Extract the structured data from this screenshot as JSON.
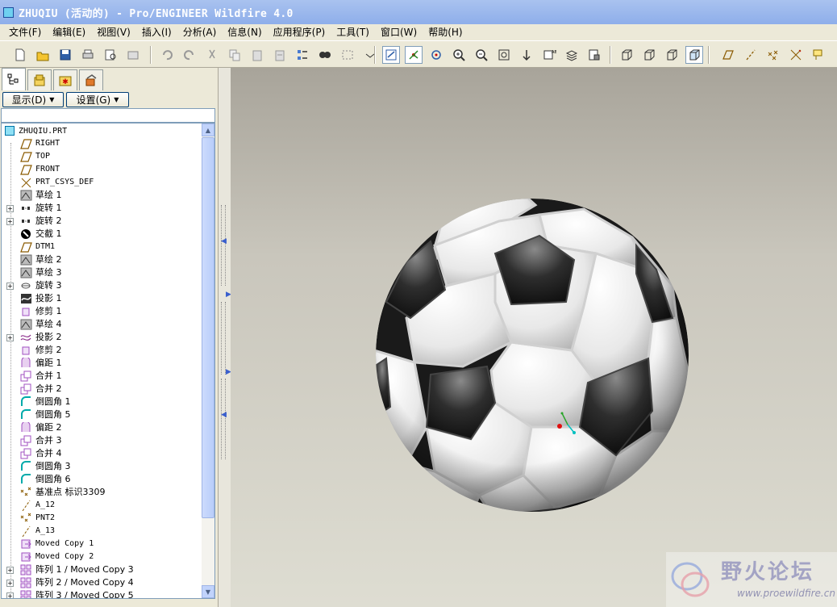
{
  "window": {
    "title": "ZHUQIU (活动的) - Pro/ENGINEER Wildfire 4.0"
  },
  "menu": [
    {
      "label": "文件(F)"
    },
    {
      "label": "编辑(E)"
    },
    {
      "label": "视图(V)"
    },
    {
      "label": "插入(I)"
    },
    {
      "label": "分析(A)"
    },
    {
      "label": "信息(N)"
    },
    {
      "label": "应用程序(P)"
    },
    {
      "label": "工具(T)"
    },
    {
      "label": "窗口(W)"
    },
    {
      "label": "帮助(H)"
    }
  ],
  "toolbar_icons": [
    "new-file",
    "open-folder",
    "save",
    "print",
    "print-preview",
    "email",
    "undo",
    "redo",
    "cut",
    "copy",
    "paste",
    "paste-special",
    "regenerate",
    "find",
    "select-box",
    "saved-views",
    "repaint",
    "spin-center",
    "orient",
    "zoom-in",
    "zoom-out",
    "refit",
    "reorient",
    "named-views",
    "layers",
    "view-manager",
    "wireframe",
    "hidden-line",
    "no-hidden",
    "shading",
    "datum-plane",
    "datum-axis",
    "datum-point",
    "csys",
    "annotation"
  ],
  "panel": {
    "display_button": "显示(D)",
    "settings_button": "设置(G)"
  },
  "tree": {
    "root": "ZHUQIU.PRT",
    "items": [
      {
        "label": "RIGHT",
        "icon": "datum-plane",
        "expandable": false,
        "mono": true
      },
      {
        "label": "TOP",
        "icon": "datum-plane",
        "expandable": false,
        "mono": true
      },
      {
        "label": "FRONT",
        "icon": "datum-plane",
        "expandable": false,
        "mono": true
      },
      {
        "label": "PRT_CSYS_DEF",
        "icon": "csys",
        "expandable": false,
        "mono": true
      },
      {
        "label": "草绘 1",
        "icon": "sketch",
        "expandable": false
      },
      {
        "label": "旋转 1",
        "icon": "revolve",
        "expandable": true
      },
      {
        "label": "旋转 2",
        "icon": "revolve",
        "expandable": true
      },
      {
        "label": "交截 1",
        "icon": "intersect",
        "expandable": false
      },
      {
        "label": "DTM1",
        "icon": "datum-plane",
        "expandable": false,
        "mono": true
      },
      {
        "label": "草绘 2",
        "icon": "sketch",
        "expandable": false
      },
      {
        "label": "草绘 3",
        "icon": "sketch",
        "expandable": false
      },
      {
        "label": "旋转 3",
        "icon": "revolve-surface",
        "expandable": true
      },
      {
        "label": "投影 1",
        "icon": "project",
        "expandable": false
      },
      {
        "label": "修剪 1",
        "icon": "trim",
        "expandable": false
      },
      {
        "label": "草绘 4",
        "icon": "sketch",
        "expandable": false
      },
      {
        "label": "投影 2",
        "icon": "project-curve",
        "expandable": true
      },
      {
        "label": "修剪 2",
        "icon": "trim",
        "expandable": false
      },
      {
        "label": "偏距 1",
        "icon": "offset",
        "expandable": false
      },
      {
        "label": "合并 1",
        "icon": "merge",
        "expandable": false
      },
      {
        "label": "合并 2",
        "icon": "merge",
        "expandable": false
      },
      {
        "label": "倒圆角 1",
        "icon": "round",
        "expandable": false
      },
      {
        "label": "倒圆角 5",
        "icon": "round",
        "expandable": false
      },
      {
        "label": "偏距 2",
        "icon": "offset",
        "expandable": false
      },
      {
        "label": "合并 3",
        "icon": "merge",
        "expandable": false
      },
      {
        "label": "合并 4",
        "icon": "merge",
        "expandable": false
      },
      {
        "label": "倒圆角 3",
        "icon": "round",
        "expandable": false
      },
      {
        "label": "倒圆角 6",
        "icon": "round",
        "expandable": false
      },
      {
        "label": "基准点 标识3309",
        "icon": "datum-point",
        "expandable": false
      },
      {
        "label": "A_12",
        "icon": "datum-axis",
        "expandable": false,
        "mono": true
      },
      {
        "label": "PNT2",
        "icon": "datum-point",
        "expandable": false,
        "mono": true
      },
      {
        "label": "A_13",
        "icon": "datum-axis",
        "expandable": false,
        "mono": true
      },
      {
        "label": "Moved Copy 1",
        "icon": "moved-copy",
        "expandable": false,
        "mono": true
      },
      {
        "label": "Moved Copy 2",
        "icon": "moved-copy",
        "expandable": false,
        "mono": true
      },
      {
        "label": "阵列 1 / Moved Copy 3",
        "icon": "pattern",
        "expandable": true
      },
      {
        "label": "阵列 2 / Moved Copy 4",
        "icon": "pattern",
        "expandable": true
      },
      {
        "label": "阵列 3 / Moved Copy 5",
        "icon": "pattern",
        "expandable": true
      }
    ]
  },
  "watermark": {
    "text": "野火论坛",
    "url": "www.proewildfire.cn"
  }
}
